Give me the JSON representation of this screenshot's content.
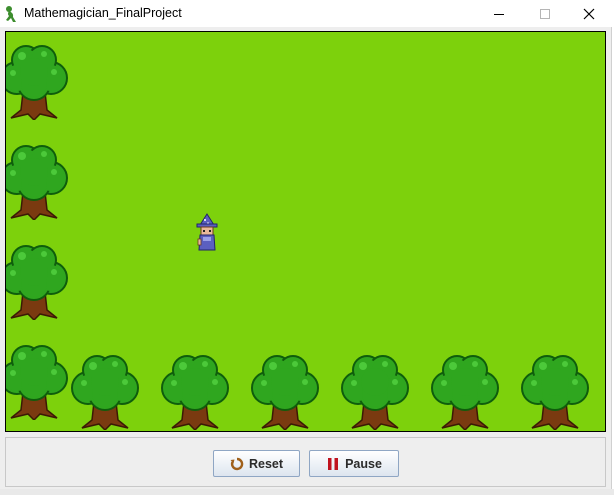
{
  "window": {
    "title": "Mathemagician_FinalProject",
    "icon": "app-figure-icon",
    "controls": [
      "minimize-icon",
      "maximize-icon",
      "close-icon"
    ]
  },
  "game": {
    "background_color": "#7dd10c",
    "player": {
      "sprite": "wizard-icon"
    },
    "obstacles": {
      "sprite": "tree-icon"
    }
  },
  "controls": {
    "reset_label": "Reset",
    "reset_icon": "reset-icon",
    "pause_label": "Pause",
    "pause_icon": "pause-icon"
  }
}
